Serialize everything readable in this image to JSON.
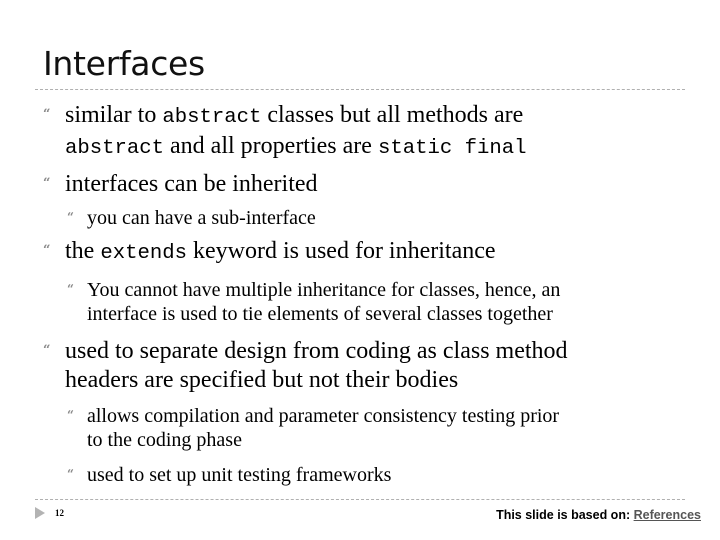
{
  "slide": {
    "title": "Interfaces",
    "page_number": "12",
    "footer": {
      "prefix": "This slide is based on: ",
      "link_label": "References"
    },
    "bullet_icon": "quote-bullet",
    "items": [
      {
        "level": 1,
        "parts": [
          {
            "t": "similar to "
          },
          {
            "t": "abstract",
            "mono": true
          },
          {
            "t": " classes but all methods are"
          },
          {
            "br": true
          },
          {
            "t": "abstract",
            "mono": true
          },
          {
            "t": " and all properties are "
          },
          {
            "t": "static final",
            "mono": true
          }
        ]
      },
      {
        "level": 1,
        "parts": [
          {
            "t": "interfaces can be inherited"
          }
        ]
      },
      {
        "level": 2,
        "parts": [
          {
            "t": "you can have a sub-interface"
          }
        ]
      },
      {
        "level": 1,
        "parts": [
          {
            "t": "the "
          },
          {
            "t": "extends",
            "mono": true
          },
          {
            "t": " keyword is used for inheritance"
          }
        ]
      },
      {
        "level": 2,
        "parts": [
          {
            "t": "You cannot have multiple inheritance for classes, hence, an"
          },
          {
            "br": true
          },
          {
            "t": "interface is used to tie elements of several classes together"
          }
        ]
      },
      {
        "level": 1,
        "parts": [
          {
            "t": "used to separate design from coding as class method"
          },
          {
            "br": true
          },
          {
            "t": "headers are specified but not their bodies"
          }
        ]
      },
      {
        "level": 2,
        "parts": [
          {
            "t": "allows compilation and parameter consistency testing prior"
          },
          {
            "br": true
          },
          {
            "t": "to the coding phase"
          }
        ]
      },
      {
        "level": 2,
        "parts": [
          {
            "t": "used to set up unit testing frameworks"
          }
        ]
      }
    ]
  }
}
